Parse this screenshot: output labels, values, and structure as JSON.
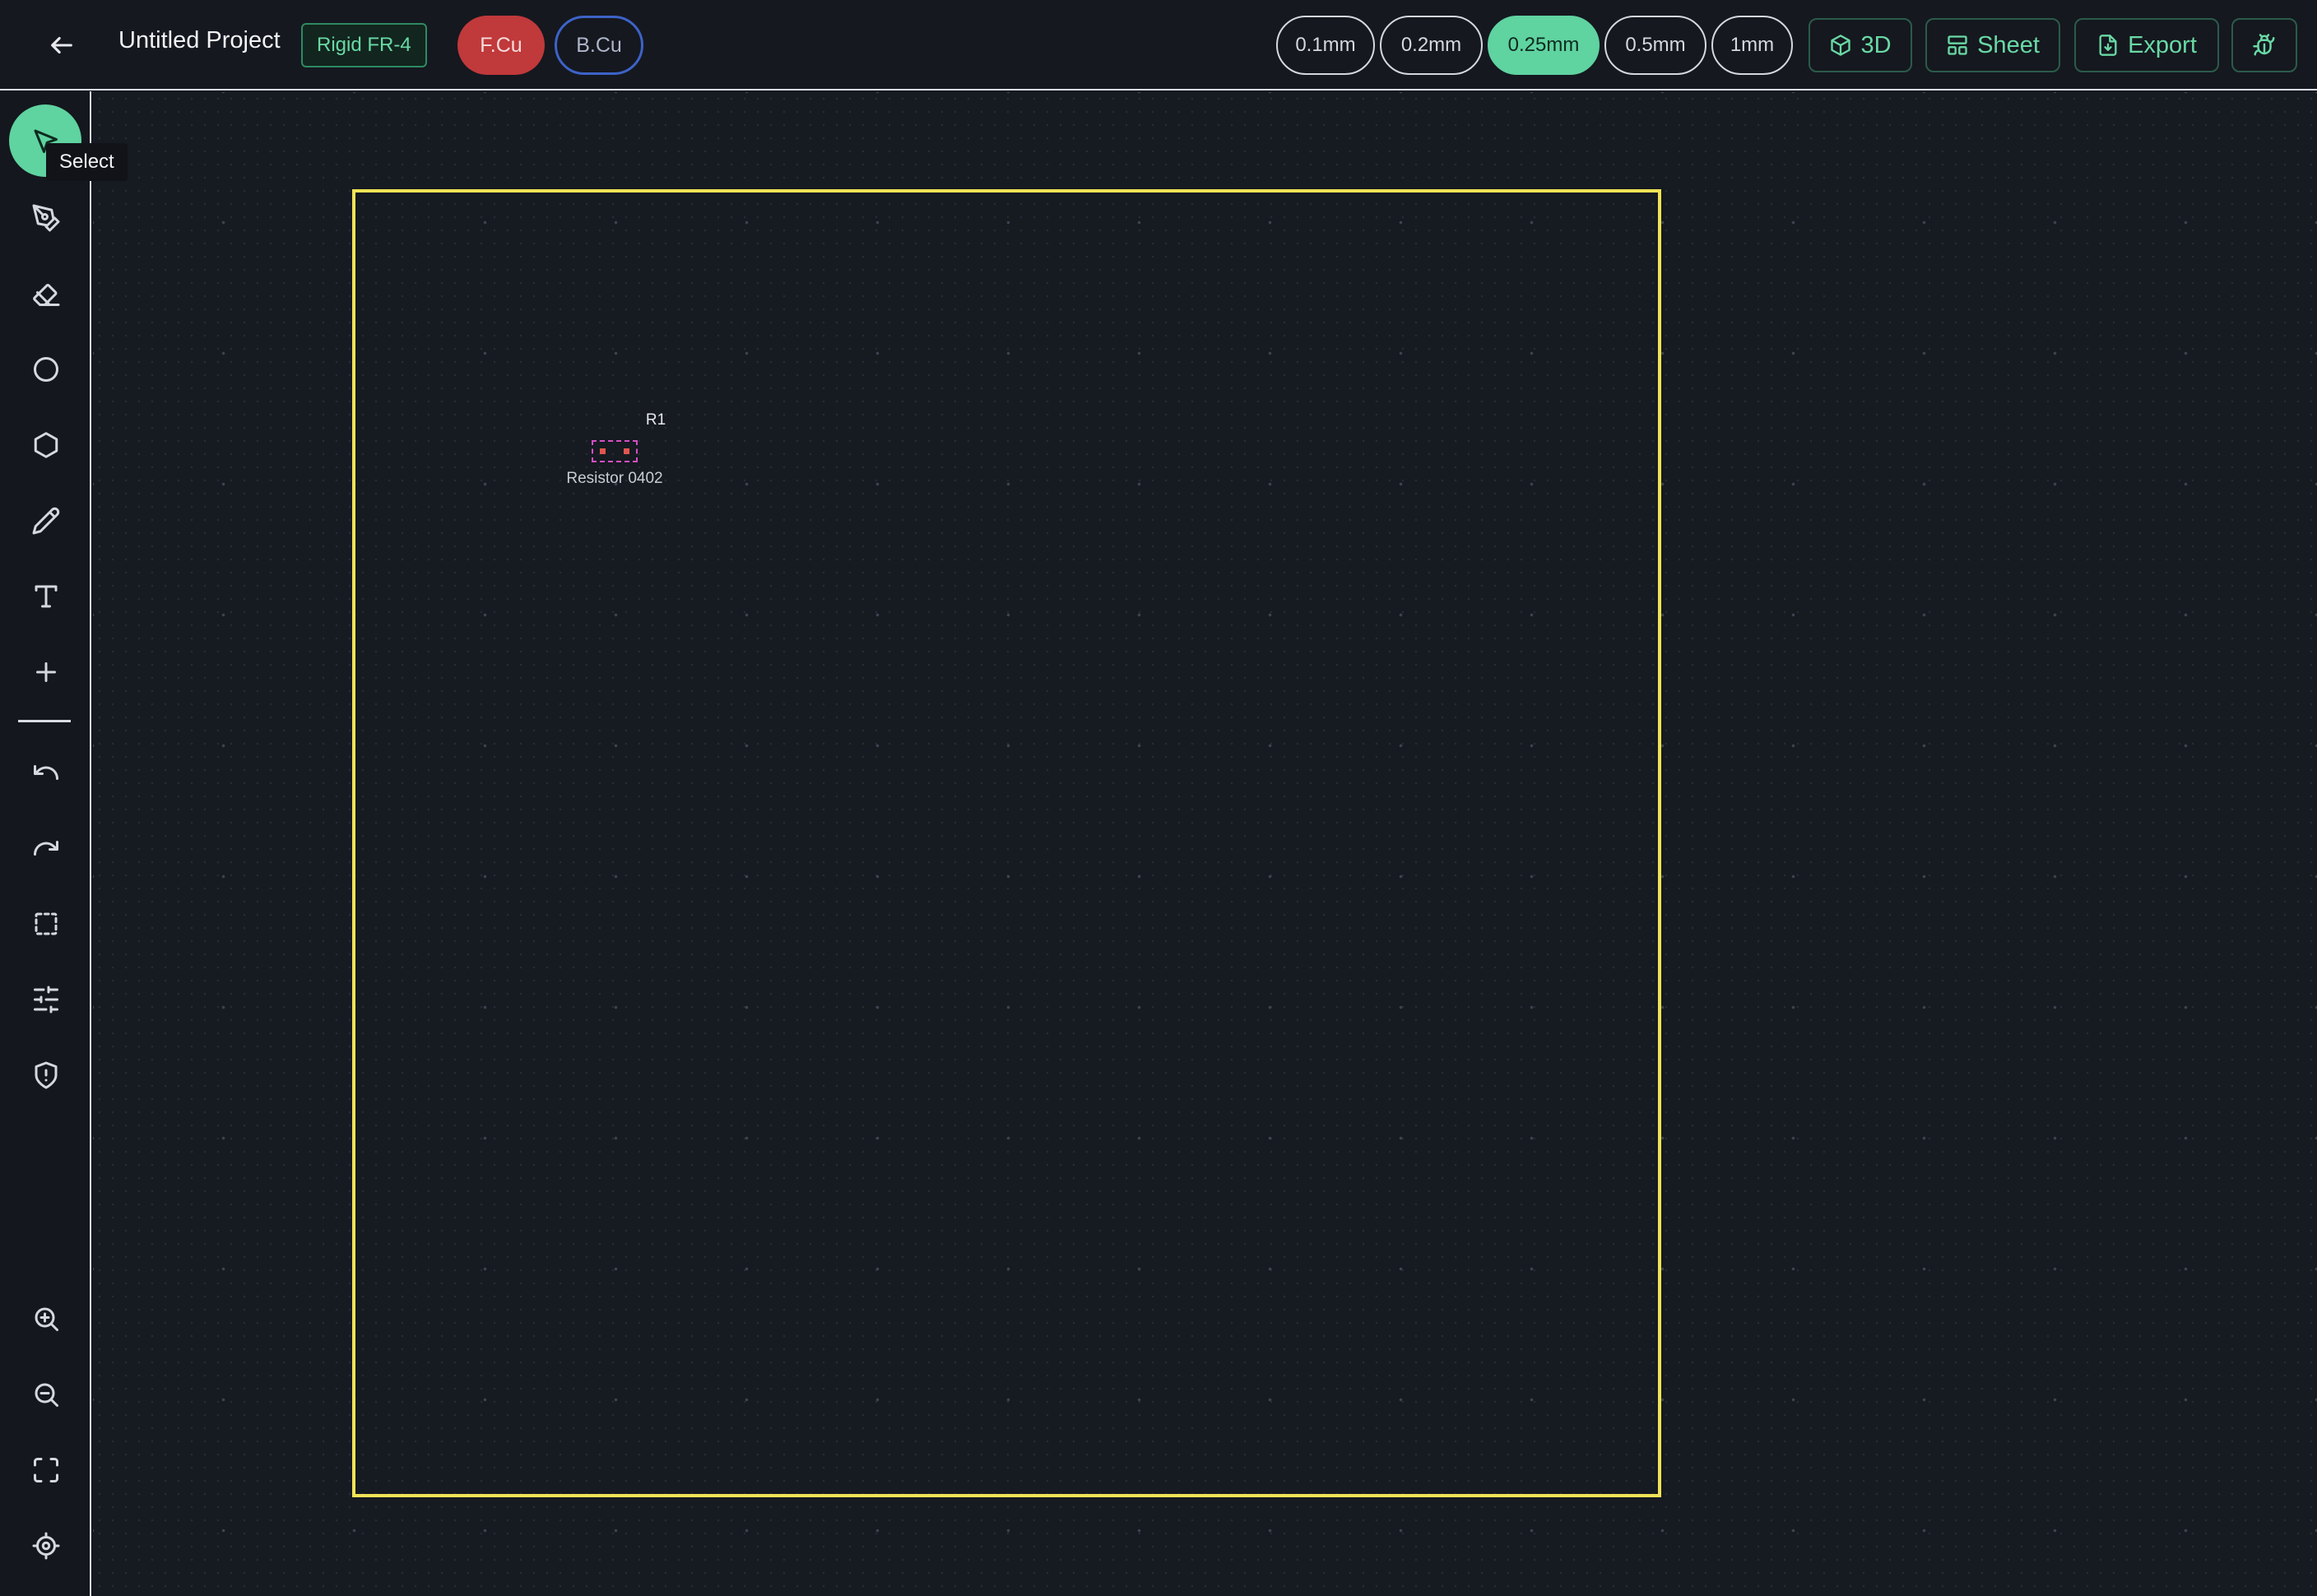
{
  "header": {
    "project_title": "Untitled Project",
    "material_badge": "Rigid FR-4",
    "layers": [
      {
        "label": "F.Cu",
        "active": true,
        "color": "#c0393b"
      },
      {
        "label": "B.Cu",
        "active": false,
        "color": "#3d63c8"
      }
    ],
    "grid_sizes": [
      {
        "label": "0.1mm",
        "active": false
      },
      {
        "label": "0.2mm",
        "active": false
      },
      {
        "label": "0.25mm",
        "active": true
      },
      {
        "label": "0.5mm",
        "active": false
      },
      {
        "label": "1mm",
        "active": false
      }
    ],
    "actions": {
      "view_3d_label": "3D",
      "sheet_label": "Sheet",
      "export_label": "Export"
    }
  },
  "toolbar": {
    "active_tool": "select",
    "tooltip": "Select",
    "tools": [
      {
        "name": "select",
        "icon": "cursor-arrow-icon"
      },
      {
        "name": "route",
        "icon": "pen-nib-icon"
      },
      {
        "name": "erase",
        "icon": "eraser-icon"
      },
      {
        "name": "circle",
        "icon": "circle-icon"
      },
      {
        "name": "polygon",
        "icon": "hexagon-icon"
      },
      {
        "name": "draw",
        "icon": "pencil-icon"
      },
      {
        "name": "text",
        "icon": "text-icon"
      },
      {
        "name": "add",
        "icon": "plus-icon"
      },
      {
        "name": "undo",
        "icon": "undo-icon"
      },
      {
        "name": "redo",
        "icon": "redo-icon"
      },
      {
        "name": "selection-box",
        "icon": "dashed-square-icon"
      },
      {
        "name": "settings",
        "icon": "sliders-icon"
      },
      {
        "name": "drc",
        "icon": "shield-alert-icon"
      },
      {
        "name": "zoom-in",
        "icon": "zoom-in-icon"
      },
      {
        "name": "zoom-out",
        "icon": "zoom-out-icon"
      },
      {
        "name": "fit",
        "icon": "fullscreen-icon"
      },
      {
        "name": "center",
        "icon": "crosshair-icon"
      }
    ]
  },
  "canvas": {
    "board_outline_color": "#f1e356",
    "component": {
      "reference": "R1",
      "value": "Resistor 0402",
      "outline_color": "#d64fc5",
      "pad_color": "#e0554f"
    }
  },
  "colors": {
    "accent": "#5fd3a0",
    "background": "#15181f"
  }
}
